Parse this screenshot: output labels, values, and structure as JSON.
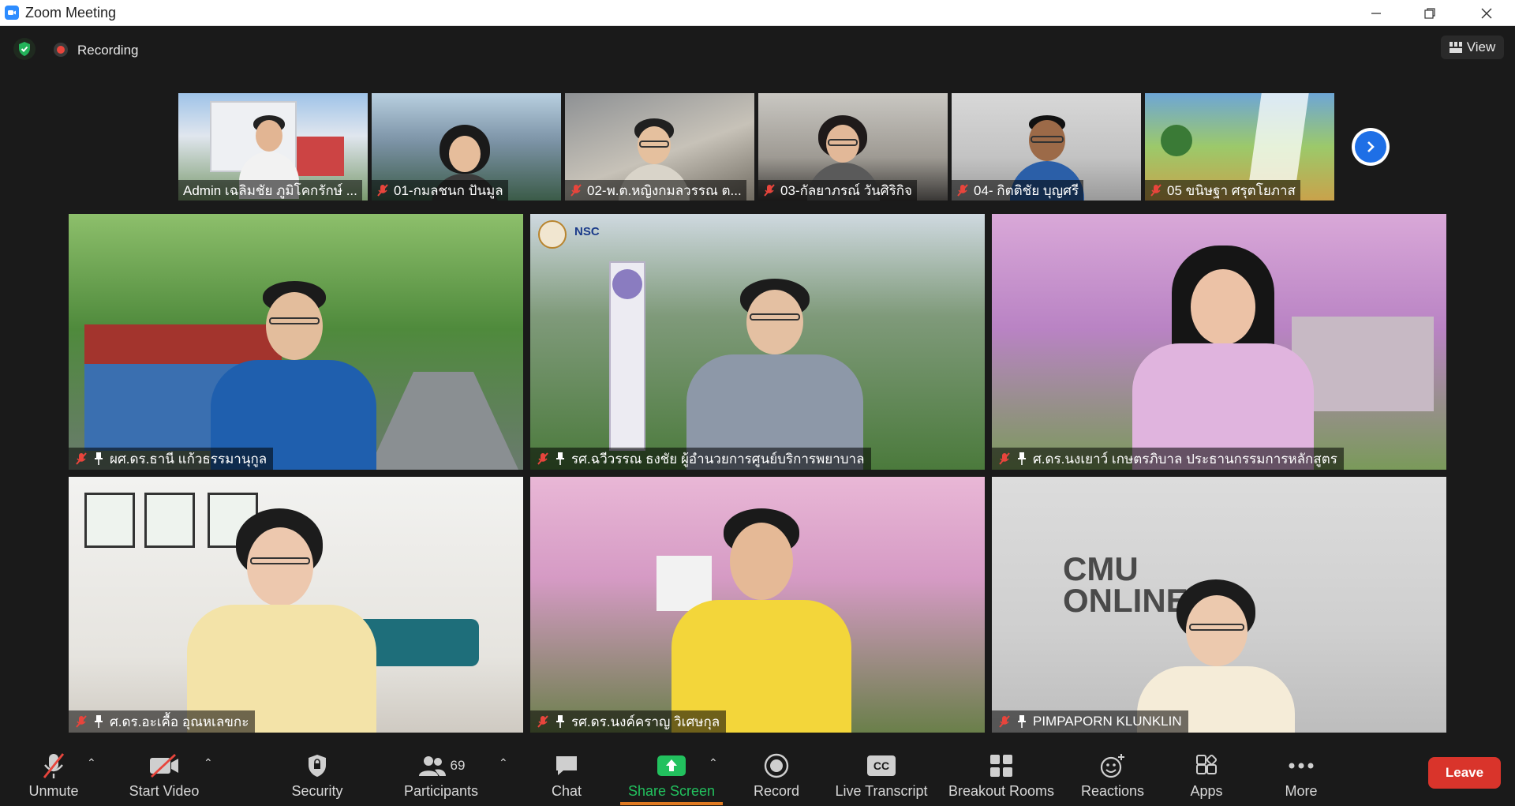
{
  "window": {
    "title": "Zoom Meeting",
    "minimize": "—",
    "restore": "❐",
    "close": "✕"
  },
  "meeting_bar": {
    "recording_label": "Recording",
    "view_label": "View"
  },
  "thumbnails": [
    {
      "name": "Admin เฉลิมชัย  ภูมิโคกรักษ์ ...",
      "muted": false
    },
    {
      "name": "01-กมลชนก ปันมูล",
      "muted": true
    },
    {
      "name": "02-พ.ต.หญิงกมลวรรณ ต...",
      "muted": true
    },
    {
      "name": "03-กัลยาภรณ์ วันศิริกิจ",
      "muted": true
    },
    {
      "name": "04- กิตติชัย บุญศรี",
      "muted": true
    },
    {
      "name": "05 ขนิษฐา  ศรุตโยภาส",
      "muted": true
    }
  ],
  "gallery": [
    {
      "name": "ผศ.ดร.ธานี  แก้วธรรมานุกูล",
      "muted": true,
      "pinned": true
    },
    {
      "name": "รศ.ฉวีวรรณ ธงชัย ผู้อำนวยการศูนย์บริการพยาบาล",
      "muted": true,
      "pinned": true
    },
    {
      "name": "ศ.ดร.นงเยาว์  เกษตรภิบาล ประธานกรรมการหลักสูตร",
      "muted": true,
      "pinned": true
    },
    {
      "name": "ศ.ดร.อะเคื้อ อุณหเลขกะ",
      "muted": true,
      "pinned": true
    },
    {
      "name": "รศ.ดร.นงค์คราญ วิเศษกุล",
      "muted": true,
      "pinned": true
    },
    {
      "name": "PIMPAPORN KLUNKLIN",
      "muted": true,
      "pinned": true
    }
  ],
  "tile_text": {
    "cmu_line1": "CMU",
    "cmu_line2": "ONLINE",
    "nsc": "NSC"
  },
  "toolbar": {
    "unmute": "Unmute",
    "start_video": "Start Video",
    "security": "Security",
    "participants": "Participants",
    "participants_count": "69",
    "chat": "Chat",
    "share_screen": "Share Screen",
    "record": "Record",
    "live_transcript": "Live Transcript",
    "cc": "CC",
    "breakout_rooms": "Breakout Rooms",
    "reactions": "Reactions",
    "apps": "Apps",
    "more": "More",
    "leave": "Leave"
  },
  "colors": {
    "accent": "#2d8cff",
    "leave": "#d9342b",
    "share": "#22c15e",
    "mute_red": "#e8453c"
  }
}
